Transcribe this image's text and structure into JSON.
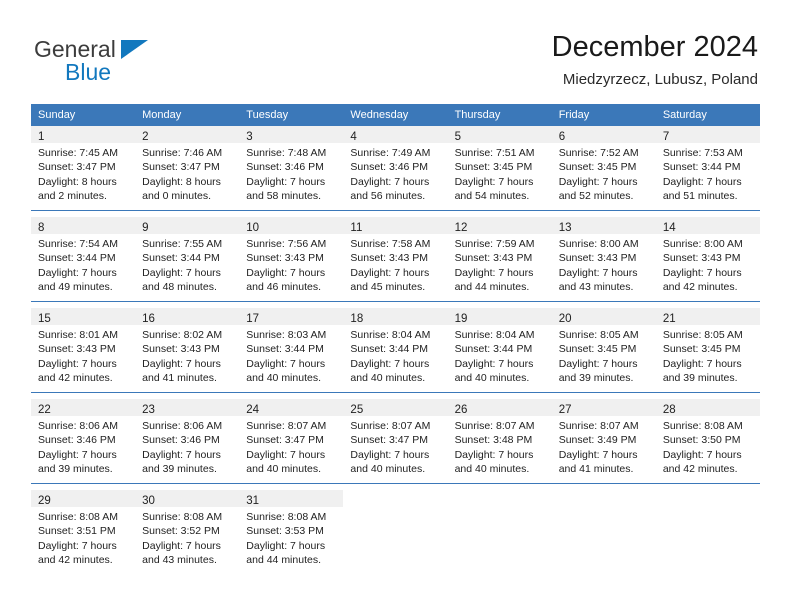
{
  "brand": {
    "line1": "General",
    "line2": "Blue",
    "colors": {
      "dark": "#3c3c3c",
      "blue": "#1278be"
    }
  },
  "header": {
    "title": "December 2024",
    "subtitle": "Miedzyrzecz, Lubusz, Poland"
  },
  "calendar": {
    "accent_color": "#3b78b9",
    "daynum_bg": "#f0f0f0",
    "weekday_headers": [
      "Sunday",
      "Monday",
      "Tuesday",
      "Wednesday",
      "Thursday",
      "Friday",
      "Saturday"
    ],
    "weeks": [
      [
        {
          "day": "1",
          "sunrise": "Sunrise: 7:45 AM",
          "sunset": "Sunset: 3:47 PM",
          "daylight1": "Daylight: 8 hours",
          "daylight2": "and 2 minutes."
        },
        {
          "day": "2",
          "sunrise": "Sunrise: 7:46 AM",
          "sunset": "Sunset: 3:47 PM",
          "daylight1": "Daylight: 8 hours",
          "daylight2": "and 0 minutes."
        },
        {
          "day": "3",
          "sunrise": "Sunrise: 7:48 AM",
          "sunset": "Sunset: 3:46 PM",
          "daylight1": "Daylight: 7 hours",
          "daylight2": "and 58 minutes."
        },
        {
          "day": "4",
          "sunrise": "Sunrise: 7:49 AM",
          "sunset": "Sunset: 3:46 PM",
          "daylight1": "Daylight: 7 hours",
          "daylight2": "and 56 minutes."
        },
        {
          "day": "5",
          "sunrise": "Sunrise: 7:51 AM",
          "sunset": "Sunset: 3:45 PM",
          "daylight1": "Daylight: 7 hours",
          "daylight2": "and 54 minutes."
        },
        {
          "day": "6",
          "sunrise": "Sunrise: 7:52 AM",
          "sunset": "Sunset: 3:45 PM",
          "daylight1": "Daylight: 7 hours",
          "daylight2": "and 52 minutes."
        },
        {
          "day": "7",
          "sunrise": "Sunrise: 7:53 AM",
          "sunset": "Sunset: 3:44 PM",
          "daylight1": "Daylight: 7 hours",
          "daylight2": "and 51 minutes."
        }
      ],
      [
        {
          "day": "8",
          "sunrise": "Sunrise: 7:54 AM",
          "sunset": "Sunset: 3:44 PM",
          "daylight1": "Daylight: 7 hours",
          "daylight2": "and 49 minutes."
        },
        {
          "day": "9",
          "sunrise": "Sunrise: 7:55 AM",
          "sunset": "Sunset: 3:44 PM",
          "daylight1": "Daylight: 7 hours",
          "daylight2": "and 48 minutes."
        },
        {
          "day": "10",
          "sunrise": "Sunrise: 7:56 AM",
          "sunset": "Sunset: 3:43 PM",
          "daylight1": "Daylight: 7 hours",
          "daylight2": "and 46 minutes."
        },
        {
          "day": "11",
          "sunrise": "Sunrise: 7:58 AM",
          "sunset": "Sunset: 3:43 PM",
          "daylight1": "Daylight: 7 hours",
          "daylight2": "and 45 minutes."
        },
        {
          "day": "12",
          "sunrise": "Sunrise: 7:59 AM",
          "sunset": "Sunset: 3:43 PM",
          "daylight1": "Daylight: 7 hours",
          "daylight2": "and 44 minutes."
        },
        {
          "day": "13",
          "sunrise": "Sunrise: 8:00 AM",
          "sunset": "Sunset: 3:43 PM",
          "daylight1": "Daylight: 7 hours",
          "daylight2": "and 43 minutes."
        },
        {
          "day": "14",
          "sunrise": "Sunrise: 8:00 AM",
          "sunset": "Sunset: 3:43 PM",
          "daylight1": "Daylight: 7 hours",
          "daylight2": "and 42 minutes."
        }
      ],
      [
        {
          "day": "15",
          "sunrise": "Sunrise: 8:01 AM",
          "sunset": "Sunset: 3:43 PM",
          "daylight1": "Daylight: 7 hours",
          "daylight2": "and 42 minutes."
        },
        {
          "day": "16",
          "sunrise": "Sunrise: 8:02 AM",
          "sunset": "Sunset: 3:43 PM",
          "daylight1": "Daylight: 7 hours",
          "daylight2": "and 41 minutes."
        },
        {
          "day": "17",
          "sunrise": "Sunrise: 8:03 AM",
          "sunset": "Sunset: 3:44 PM",
          "daylight1": "Daylight: 7 hours",
          "daylight2": "and 40 minutes."
        },
        {
          "day": "18",
          "sunrise": "Sunrise: 8:04 AM",
          "sunset": "Sunset: 3:44 PM",
          "daylight1": "Daylight: 7 hours",
          "daylight2": "and 40 minutes."
        },
        {
          "day": "19",
          "sunrise": "Sunrise: 8:04 AM",
          "sunset": "Sunset: 3:44 PM",
          "daylight1": "Daylight: 7 hours",
          "daylight2": "and 40 minutes."
        },
        {
          "day": "20",
          "sunrise": "Sunrise: 8:05 AM",
          "sunset": "Sunset: 3:45 PM",
          "daylight1": "Daylight: 7 hours",
          "daylight2": "and 39 minutes."
        },
        {
          "day": "21",
          "sunrise": "Sunrise: 8:05 AM",
          "sunset": "Sunset: 3:45 PM",
          "daylight1": "Daylight: 7 hours",
          "daylight2": "and 39 minutes."
        }
      ],
      [
        {
          "day": "22",
          "sunrise": "Sunrise: 8:06 AM",
          "sunset": "Sunset: 3:46 PM",
          "daylight1": "Daylight: 7 hours",
          "daylight2": "and 39 minutes."
        },
        {
          "day": "23",
          "sunrise": "Sunrise: 8:06 AM",
          "sunset": "Sunset: 3:46 PM",
          "daylight1": "Daylight: 7 hours",
          "daylight2": "and 39 minutes."
        },
        {
          "day": "24",
          "sunrise": "Sunrise: 8:07 AM",
          "sunset": "Sunset: 3:47 PM",
          "daylight1": "Daylight: 7 hours",
          "daylight2": "and 40 minutes."
        },
        {
          "day": "25",
          "sunrise": "Sunrise: 8:07 AM",
          "sunset": "Sunset: 3:47 PM",
          "daylight1": "Daylight: 7 hours",
          "daylight2": "and 40 minutes."
        },
        {
          "day": "26",
          "sunrise": "Sunrise: 8:07 AM",
          "sunset": "Sunset: 3:48 PM",
          "daylight1": "Daylight: 7 hours",
          "daylight2": "and 40 minutes."
        },
        {
          "day": "27",
          "sunrise": "Sunrise: 8:07 AM",
          "sunset": "Sunset: 3:49 PM",
          "daylight1": "Daylight: 7 hours",
          "daylight2": "and 41 minutes."
        },
        {
          "day": "28",
          "sunrise": "Sunrise: 8:08 AM",
          "sunset": "Sunset: 3:50 PM",
          "daylight1": "Daylight: 7 hours",
          "daylight2": "and 42 minutes."
        }
      ],
      [
        {
          "day": "29",
          "sunrise": "Sunrise: 8:08 AM",
          "sunset": "Sunset: 3:51 PM",
          "daylight1": "Daylight: 7 hours",
          "daylight2": "and 42 minutes."
        },
        {
          "day": "30",
          "sunrise": "Sunrise: 8:08 AM",
          "sunset": "Sunset: 3:52 PM",
          "daylight1": "Daylight: 7 hours",
          "daylight2": "and 43 minutes."
        },
        {
          "day": "31",
          "sunrise": "Sunrise: 8:08 AM",
          "sunset": "Sunset: 3:53 PM",
          "daylight1": "Daylight: 7 hours",
          "daylight2": "and 44 minutes."
        },
        {
          "day": "",
          "sunrise": "",
          "sunset": "",
          "daylight1": "",
          "daylight2": ""
        },
        {
          "day": "",
          "sunrise": "",
          "sunset": "",
          "daylight1": "",
          "daylight2": ""
        },
        {
          "day": "",
          "sunrise": "",
          "sunset": "",
          "daylight1": "",
          "daylight2": ""
        },
        {
          "day": "",
          "sunrise": "",
          "sunset": "",
          "daylight1": "",
          "daylight2": ""
        }
      ]
    ]
  }
}
